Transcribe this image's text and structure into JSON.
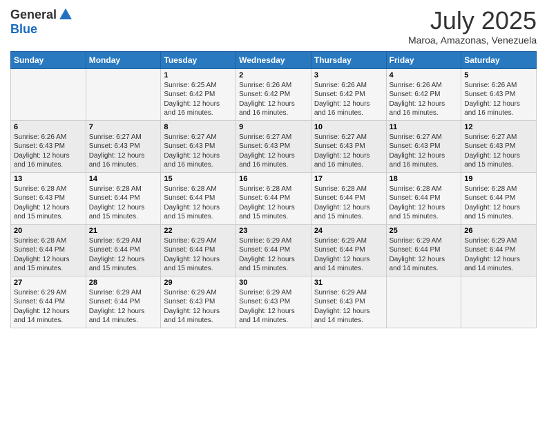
{
  "logo": {
    "general": "General",
    "blue": "Blue"
  },
  "title": "July 2025",
  "location": "Maroa, Amazonas, Venezuela",
  "days_of_week": [
    "Sunday",
    "Monday",
    "Tuesday",
    "Wednesday",
    "Thursday",
    "Friday",
    "Saturday"
  ],
  "weeks": [
    [
      {
        "day": "",
        "sunrise": "",
        "sunset": "",
        "daylight": ""
      },
      {
        "day": "",
        "sunrise": "",
        "sunset": "",
        "daylight": ""
      },
      {
        "day": "1",
        "sunrise": "Sunrise: 6:25 AM",
        "sunset": "Sunset: 6:42 PM",
        "daylight": "Daylight: 12 hours and 16 minutes."
      },
      {
        "day": "2",
        "sunrise": "Sunrise: 6:26 AM",
        "sunset": "Sunset: 6:42 PM",
        "daylight": "Daylight: 12 hours and 16 minutes."
      },
      {
        "day": "3",
        "sunrise": "Sunrise: 6:26 AM",
        "sunset": "Sunset: 6:42 PM",
        "daylight": "Daylight: 12 hours and 16 minutes."
      },
      {
        "day": "4",
        "sunrise": "Sunrise: 6:26 AM",
        "sunset": "Sunset: 6:42 PM",
        "daylight": "Daylight: 12 hours and 16 minutes."
      },
      {
        "day": "5",
        "sunrise": "Sunrise: 6:26 AM",
        "sunset": "Sunset: 6:43 PM",
        "daylight": "Daylight: 12 hours and 16 minutes."
      }
    ],
    [
      {
        "day": "6",
        "sunrise": "Sunrise: 6:26 AM",
        "sunset": "Sunset: 6:43 PM",
        "daylight": "Daylight: 12 hours and 16 minutes."
      },
      {
        "day": "7",
        "sunrise": "Sunrise: 6:27 AM",
        "sunset": "Sunset: 6:43 PM",
        "daylight": "Daylight: 12 hours and 16 minutes."
      },
      {
        "day": "8",
        "sunrise": "Sunrise: 6:27 AM",
        "sunset": "Sunset: 6:43 PM",
        "daylight": "Daylight: 12 hours and 16 minutes."
      },
      {
        "day": "9",
        "sunrise": "Sunrise: 6:27 AM",
        "sunset": "Sunset: 6:43 PM",
        "daylight": "Daylight: 12 hours and 16 minutes."
      },
      {
        "day": "10",
        "sunrise": "Sunrise: 6:27 AM",
        "sunset": "Sunset: 6:43 PM",
        "daylight": "Daylight: 12 hours and 16 minutes."
      },
      {
        "day": "11",
        "sunrise": "Sunrise: 6:27 AM",
        "sunset": "Sunset: 6:43 PM",
        "daylight": "Daylight: 12 hours and 16 minutes."
      },
      {
        "day": "12",
        "sunrise": "Sunrise: 6:27 AM",
        "sunset": "Sunset: 6:43 PM",
        "daylight": "Daylight: 12 hours and 15 minutes."
      }
    ],
    [
      {
        "day": "13",
        "sunrise": "Sunrise: 6:28 AM",
        "sunset": "Sunset: 6:43 PM",
        "daylight": "Daylight: 12 hours and 15 minutes."
      },
      {
        "day": "14",
        "sunrise": "Sunrise: 6:28 AM",
        "sunset": "Sunset: 6:44 PM",
        "daylight": "Daylight: 12 hours and 15 minutes."
      },
      {
        "day": "15",
        "sunrise": "Sunrise: 6:28 AM",
        "sunset": "Sunset: 6:44 PM",
        "daylight": "Daylight: 12 hours and 15 minutes."
      },
      {
        "day": "16",
        "sunrise": "Sunrise: 6:28 AM",
        "sunset": "Sunset: 6:44 PM",
        "daylight": "Daylight: 12 hours and 15 minutes."
      },
      {
        "day": "17",
        "sunrise": "Sunrise: 6:28 AM",
        "sunset": "Sunset: 6:44 PM",
        "daylight": "Daylight: 12 hours and 15 minutes."
      },
      {
        "day": "18",
        "sunrise": "Sunrise: 6:28 AM",
        "sunset": "Sunset: 6:44 PM",
        "daylight": "Daylight: 12 hours and 15 minutes."
      },
      {
        "day": "19",
        "sunrise": "Sunrise: 6:28 AM",
        "sunset": "Sunset: 6:44 PM",
        "daylight": "Daylight: 12 hours and 15 minutes."
      }
    ],
    [
      {
        "day": "20",
        "sunrise": "Sunrise: 6:28 AM",
        "sunset": "Sunset: 6:44 PM",
        "daylight": "Daylight: 12 hours and 15 minutes."
      },
      {
        "day": "21",
        "sunrise": "Sunrise: 6:29 AM",
        "sunset": "Sunset: 6:44 PM",
        "daylight": "Daylight: 12 hours and 15 minutes."
      },
      {
        "day": "22",
        "sunrise": "Sunrise: 6:29 AM",
        "sunset": "Sunset: 6:44 PM",
        "daylight": "Daylight: 12 hours and 15 minutes."
      },
      {
        "day": "23",
        "sunrise": "Sunrise: 6:29 AM",
        "sunset": "Sunset: 6:44 PM",
        "daylight": "Daylight: 12 hours and 15 minutes."
      },
      {
        "day": "24",
        "sunrise": "Sunrise: 6:29 AM",
        "sunset": "Sunset: 6:44 PM",
        "daylight": "Daylight: 12 hours and 14 minutes."
      },
      {
        "day": "25",
        "sunrise": "Sunrise: 6:29 AM",
        "sunset": "Sunset: 6:44 PM",
        "daylight": "Daylight: 12 hours and 14 minutes."
      },
      {
        "day": "26",
        "sunrise": "Sunrise: 6:29 AM",
        "sunset": "Sunset: 6:44 PM",
        "daylight": "Daylight: 12 hours and 14 minutes."
      }
    ],
    [
      {
        "day": "27",
        "sunrise": "Sunrise: 6:29 AM",
        "sunset": "Sunset: 6:44 PM",
        "daylight": "Daylight: 12 hours and 14 minutes."
      },
      {
        "day": "28",
        "sunrise": "Sunrise: 6:29 AM",
        "sunset": "Sunset: 6:44 PM",
        "daylight": "Daylight: 12 hours and 14 minutes."
      },
      {
        "day": "29",
        "sunrise": "Sunrise: 6:29 AM",
        "sunset": "Sunset: 6:43 PM",
        "daylight": "Daylight: 12 hours and 14 minutes."
      },
      {
        "day": "30",
        "sunrise": "Sunrise: 6:29 AM",
        "sunset": "Sunset: 6:43 PM",
        "daylight": "Daylight: 12 hours and 14 minutes."
      },
      {
        "day": "31",
        "sunrise": "Sunrise: 6:29 AM",
        "sunset": "Sunset: 6:43 PM",
        "daylight": "Daylight: 12 hours and 14 minutes."
      },
      {
        "day": "",
        "sunrise": "",
        "sunset": "",
        "daylight": ""
      },
      {
        "day": "",
        "sunrise": "",
        "sunset": "",
        "daylight": ""
      }
    ]
  ]
}
